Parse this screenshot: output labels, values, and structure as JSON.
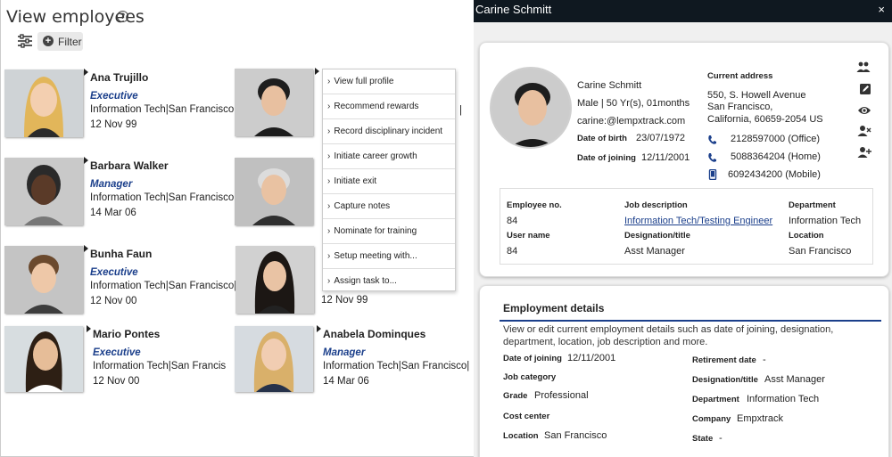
{
  "left": {
    "title": "View employees",
    "filter_label": "Filter",
    "employees": [
      {
        "name": "Ana Trujillo",
        "role": "Executive",
        "dept": "Information Tech|San Francisco|",
        "date": "12 Nov 99"
      },
      {
        "name": "Barbara Walker",
        "role": "Manager",
        "dept": "Information Tech|San Francisco|",
        "date": "14 Mar 06"
      },
      {
        "name": "Bunha Faun",
        "role": "Executive",
        "dept": "Information Tech|San Francisco|",
        "date": "12 Nov 00"
      },
      {
        "name": "Mario Pontes",
        "role": "Executive",
        "dept": "Information Tech|San Francis",
        "date": "12 Nov 00"
      },
      {
        "name": "",
        "role": "",
        "dept": "|",
        "date": ""
      },
      {
        "name": "",
        "role": "",
        "dept": "|",
        "date": ""
      },
      {
        "name": "",
        "role": "",
        "dept": "|",
        "date": "12 Nov 99"
      },
      {
        "name": "Anabela Dominques",
        "role": "Manager",
        "dept": "Information Tech|San Francisco|",
        "date": "14 Mar 06"
      }
    ],
    "context_menu": [
      "View full profile",
      "Recommend rewards",
      "Record disciplinary incident",
      "Initiate career growth",
      "Initiate exit",
      "Capture notes",
      "Nominate for training",
      "Setup meeting with...",
      "Assign task to..."
    ]
  },
  "right": {
    "window_title": "Carine Schmitt",
    "close_glyph": "×",
    "profile": {
      "name": "Carine Schmitt",
      "gender_age": "Male | 50 Yr(s), 01months",
      "email": "carine:@lempxtrack.com",
      "dob_label": "Date of birth",
      "dob": "23/07/1972",
      "doj_label": "Date of joining",
      "doj": "12/11/2001",
      "address_label": "Current address",
      "address_line1": "550, S. Howell Avenue",
      "address_line2": "San Francisco,",
      "address_line3": "California,  60659-2054 US",
      "phone_office": "2128597000 (Office)",
      "phone_home": "5088364204 (Home)",
      "phone_mobile": "6092434200 (Mobile)"
    },
    "emp_table": {
      "emp_no_label": "Employee no.",
      "emp_no": "84",
      "job_desc_label": "Job description",
      "job_desc": "Information Tech/Testing Engineer",
      "department_label": "Department",
      "department": "Information Tech",
      "username_label": "User name",
      "username": "84",
      "designation_label": "Designation/title",
      "designation": "Asst Manager",
      "location_label": "Location",
      "location": "San Francisco"
    },
    "employment": {
      "title": "Employment details",
      "description": "View or edit current employment details such as date of joining, designation, department, location, job description and more.",
      "doj_label": "Date of joining",
      "doj": "12/11/2001",
      "retirement_label": "Retirement date",
      "retirement": "-",
      "job_category_label": "Job category",
      "designation_label": "Designation/title",
      "designation": "Asst Manager",
      "grade_label": "Grade",
      "grade": "Professional",
      "department_label": "Department",
      "department": "Information Tech",
      "cost_center_label": "Cost center",
      "company_label": "Company",
      "company": "Empxtrack",
      "location_label": "Location",
      "location": "San Francisco",
      "state_label": "State",
      "state": "-"
    }
  }
}
